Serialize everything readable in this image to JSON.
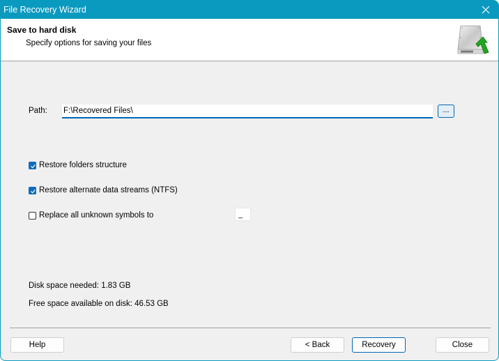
{
  "window": {
    "title": "File Recovery Wizard",
    "close_icon": "close-icon",
    "accent_color": "#0a9ac0"
  },
  "header": {
    "title": "Save to hard disk",
    "subtitle": "Specify options for saving your files",
    "icon": "hard-disk-save-icon"
  },
  "path": {
    "label": "Path:",
    "value": "F:\\Recovered Files\\",
    "browse_label": "..."
  },
  "options": [
    {
      "label": "Restore folders structure",
      "checked": true
    },
    {
      "label": "Restore alternate data streams (NTFS)",
      "checked": true
    },
    {
      "label": "Replace all unknown symbols to",
      "checked": false
    }
  ],
  "replace_symbol": {
    "value": "_"
  },
  "disk": {
    "needed": "Disk space needed: 1.83 GB",
    "free": "Free space available on disk: 46.53 GB"
  },
  "buttons": {
    "help": "Help",
    "back": "< Back",
    "recovery": "Recovery",
    "close": "Close"
  }
}
